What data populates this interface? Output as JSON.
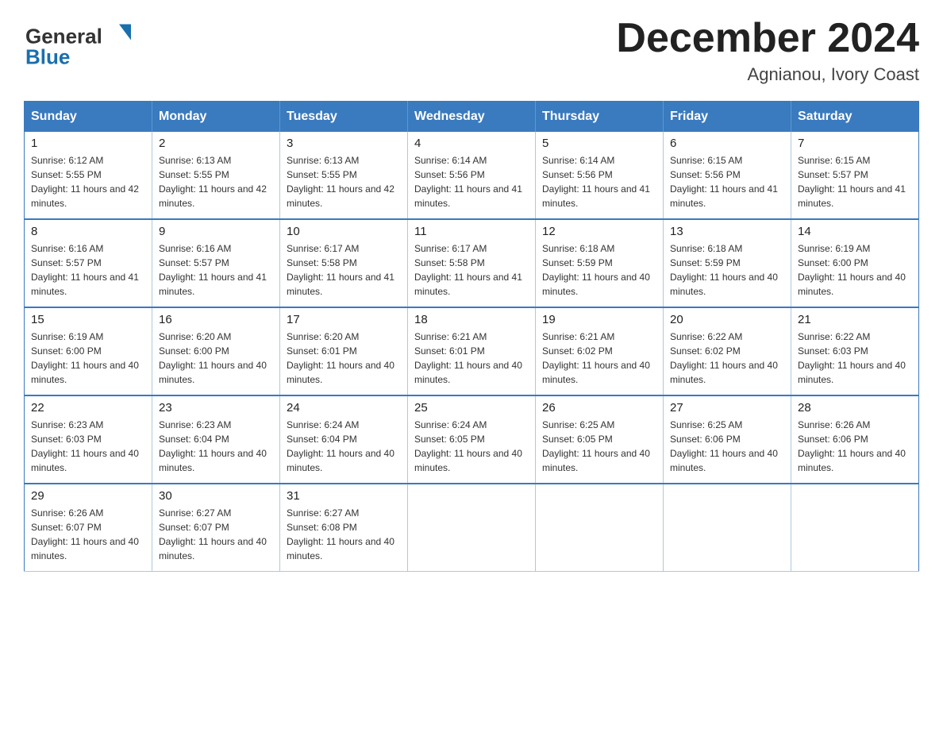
{
  "header": {
    "logo": {
      "line1": "General",
      "line2": "Blue",
      "arrow_symbol": "▶"
    },
    "title": "December 2024",
    "location": "Agnianou, Ivory Coast"
  },
  "calendar": {
    "days_of_week": [
      "Sunday",
      "Monday",
      "Tuesday",
      "Wednesday",
      "Thursday",
      "Friday",
      "Saturday"
    ],
    "weeks": [
      [
        {
          "day": "1",
          "sunrise": "6:12 AM",
          "sunset": "5:55 PM",
          "daylight": "11 hours and 42 minutes."
        },
        {
          "day": "2",
          "sunrise": "6:13 AM",
          "sunset": "5:55 PM",
          "daylight": "11 hours and 42 minutes."
        },
        {
          "day": "3",
          "sunrise": "6:13 AM",
          "sunset": "5:55 PM",
          "daylight": "11 hours and 42 minutes."
        },
        {
          "day": "4",
          "sunrise": "6:14 AM",
          "sunset": "5:56 PM",
          "daylight": "11 hours and 41 minutes."
        },
        {
          "day": "5",
          "sunrise": "6:14 AM",
          "sunset": "5:56 PM",
          "daylight": "11 hours and 41 minutes."
        },
        {
          "day": "6",
          "sunrise": "6:15 AM",
          "sunset": "5:56 PM",
          "daylight": "11 hours and 41 minutes."
        },
        {
          "day": "7",
          "sunrise": "6:15 AM",
          "sunset": "5:57 PM",
          "daylight": "11 hours and 41 minutes."
        }
      ],
      [
        {
          "day": "8",
          "sunrise": "6:16 AM",
          "sunset": "5:57 PM",
          "daylight": "11 hours and 41 minutes."
        },
        {
          "day": "9",
          "sunrise": "6:16 AM",
          "sunset": "5:57 PM",
          "daylight": "11 hours and 41 minutes."
        },
        {
          "day": "10",
          "sunrise": "6:17 AM",
          "sunset": "5:58 PM",
          "daylight": "11 hours and 41 minutes."
        },
        {
          "day": "11",
          "sunrise": "6:17 AM",
          "sunset": "5:58 PM",
          "daylight": "11 hours and 41 minutes."
        },
        {
          "day": "12",
          "sunrise": "6:18 AM",
          "sunset": "5:59 PM",
          "daylight": "11 hours and 40 minutes."
        },
        {
          "day": "13",
          "sunrise": "6:18 AM",
          "sunset": "5:59 PM",
          "daylight": "11 hours and 40 minutes."
        },
        {
          "day": "14",
          "sunrise": "6:19 AM",
          "sunset": "6:00 PM",
          "daylight": "11 hours and 40 minutes."
        }
      ],
      [
        {
          "day": "15",
          "sunrise": "6:19 AM",
          "sunset": "6:00 PM",
          "daylight": "11 hours and 40 minutes."
        },
        {
          "day": "16",
          "sunrise": "6:20 AM",
          "sunset": "6:00 PM",
          "daylight": "11 hours and 40 minutes."
        },
        {
          "day": "17",
          "sunrise": "6:20 AM",
          "sunset": "6:01 PM",
          "daylight": "11 hours and 40 minutes."
        },
        {
          "day": "18",
          "sunrise": "6:21 AM",
          "sunset": "6:01 PM",
          "daylight": "11 hours and 40 minutes."
        },
        {
          "day": "19",
          "sunrise": "6:21 AM",
          "sunset": "6:02 PM",
          "daylight": "11 hours and 40 minutes."
        },
        {
          "day": "20",
          "sunrise": "6:22 AM",
          "sunset": "6:02 PM",
          "daylight": "11 hours and 40 minutes."
        },
        {
          "day": "21",
          "sunrise": "6:22 AM",
          "sunset": "6:03 PM",
          "daylight": "11 hours and 40 minutes."
        }
      ],
      [
        {
          "day": "22",
          "sunrise": "6:23 AM",
          "sunset": "6:03 PM",
          "daylight": "11 hours and 40 minutes."
        },
        {
          "day": "23",
          "sunrise": "6:23 AM",
          "sunset": "6:04 PM",
          "daylight": "11 hours and 40 minutes."
        },
        {
          "day": "24",
          "sunrise": "6:24 AM",
          "sunset": "6:04 PM",
          "daylight": "11 hours and 40 minutes."
        },
        {
          "day": "25",
          "sunrise": "6:24 AM",
          "sunset": "6:05 PM",
          "daylight": "11 hours and 40 minutes."
        },
        {
          "day": "26",
          "sunrise": "6:25 AM",
          "sunset": "6:05 PM",
          "daylight": "11 hours and 40 minutes."
        },
        {
          "day": "27",
          "sunrise": "6:25 AM",
          "sunset": "6:06 PM",
          "daylight": "11 hours and 40 minutes."
        },
        {
          "day": "28",
          "sunrise": "6:26 AM",
          "sunset": "6:06 PM",
          "daylight": "11 hours and 40 minutes."
        }
      ],
      [
        {
          "day": "29",
          "sunrise": "6:26 AM",
          "sunset": "6:07 PM",
          "daylight": "11 hours and 40 minutes."
        },
        {
          "day": "30",
          "sunrise": "6:27 AM",
          "sunset": "6:07 PM",
          "daylight": "11 hours and 40 minutes."
        },
        {
          "day": "31",
          "sunrise": "6:27 AM",
          "sunset": "6:08 PM",
          "daylight": "11 hours and 40 minutes."
        },
        null,
        null,
        null,
        null
      ]
    ]
  }
}
